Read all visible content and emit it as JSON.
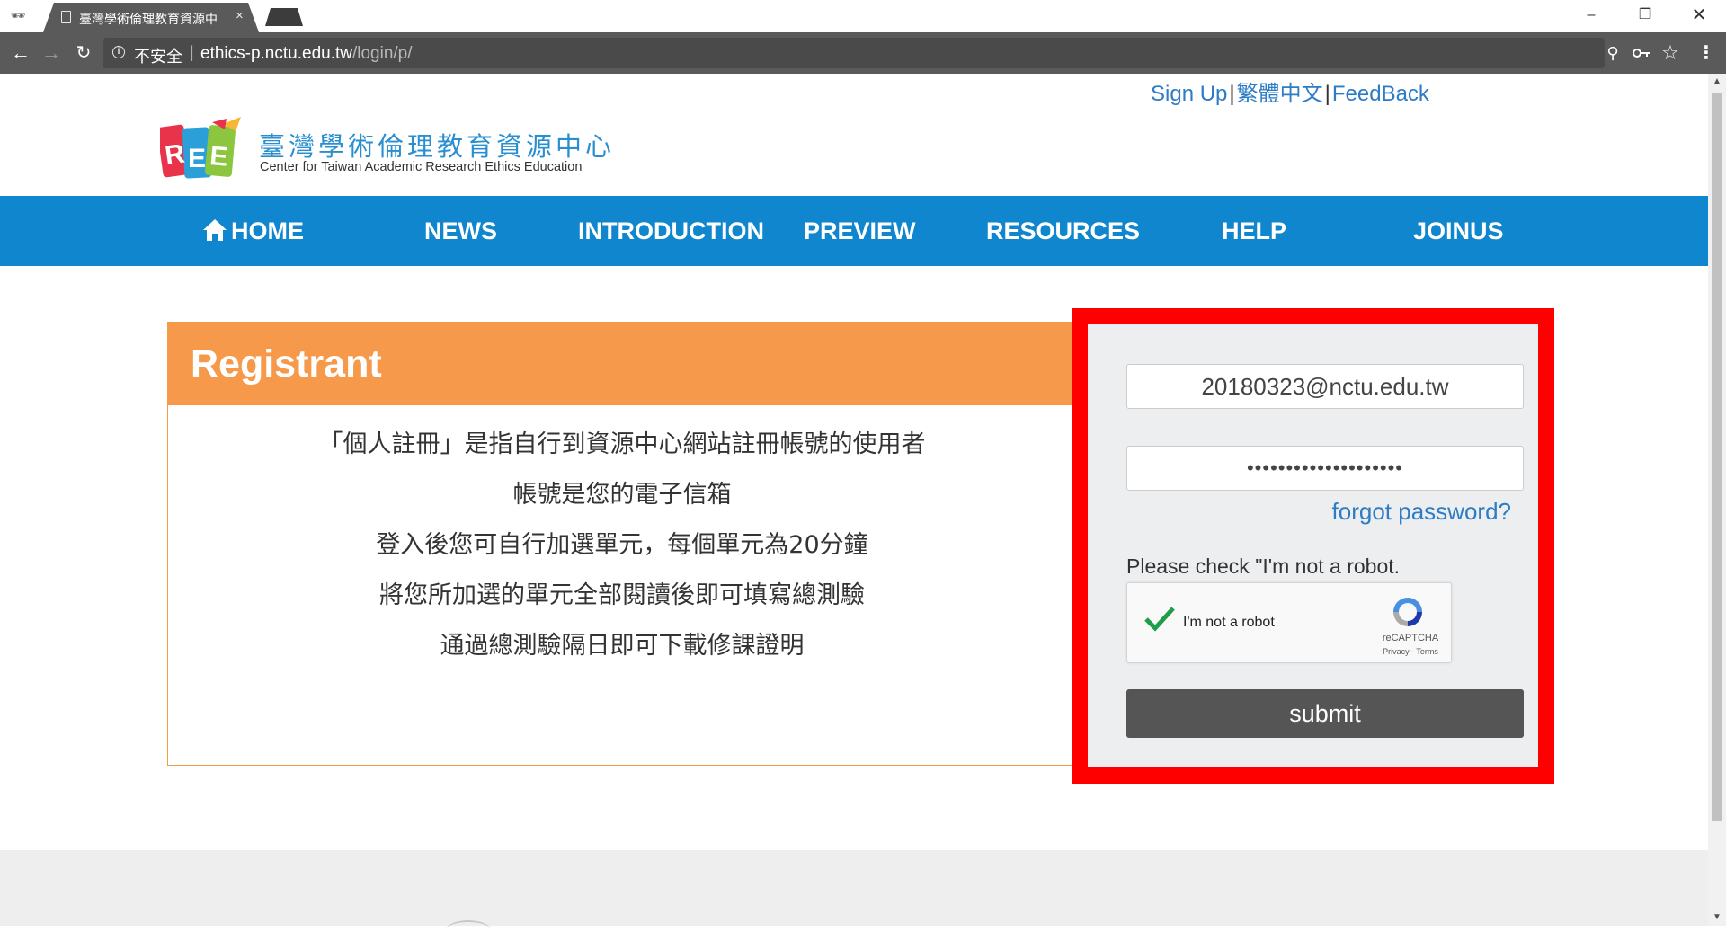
{
  "browser": {
    "tab_title": "臺灣學術倫理教育資源中",
    "tab_close": "×",
    "security_label": "不安全",
    "url_host": "ethics-p.nctu.edu.tw",
    "url_path": "/login/p/",
    "window_controls": {
      "minimize": "–",
      "restore": "❐",
      "close": "✕"
    }
  },
  "header_links": {
    "sign_up": "Sign Up",
    "language": "繁體中文",
    "feedback": "FeedBack",
    "separator": "|"
  },
  "logo": {
    "title_zh": "臺灣學術倫理教育資源中心",
    "title_en": "Center for Taiwan Academic Research Ethics Education"
  },
  "nav": {
    "home": "HOME",
    "news": "NEWS",
    "introduction": "INTRODUCTION",
    "preview": "PREVIEW",
    "resources": "RESOURCES",
    "help": "HELP",
    "joinus": "JOINUS"
  },
  "registrant": {
    "title": "Registrant",
    "lines": [
      "「個人註冊」是指自行到資源中心網站註冊帳號的使用者",
      "帳號是您的電子信箱",
      "登入後您可自行加選單元，每個單元為20分鐘",
      "將您所加選的單元全部閱讀後即可填寫總測驗",
      "通過總測驗隔日即可下載修課證明"
    ]
  },
  "login": {
    "email_value": "20180323@nctu.edu.tw",
    "password_mask": "••••••••••••••••••••",
    "forgot_password": "forgot password?",
    "captcha_prompt": "Please check \"I'm not a robot.",
    "captcha_label": "I'm not a robot",
    "captcha_brand": "reCAPTCHA",
    "captcha_terms": "Privacy - Terms",
    "captcha_checked": true,
    "submit_label": "submit"
  },
  "colors": {
    "nav_blue": "#0f86cd",
    "registrant_orange": "#f6994a",
    "highlight_red": "#ff0000",
    "link_blue": "#2d7cc4",
    "submit_gray": "#555555"
  },
  "icons": {
    "home": "home-icon",
    "check": "checkmark-icon",
    "recaptcha": "recaptcha-logo-icon"
  }
}
